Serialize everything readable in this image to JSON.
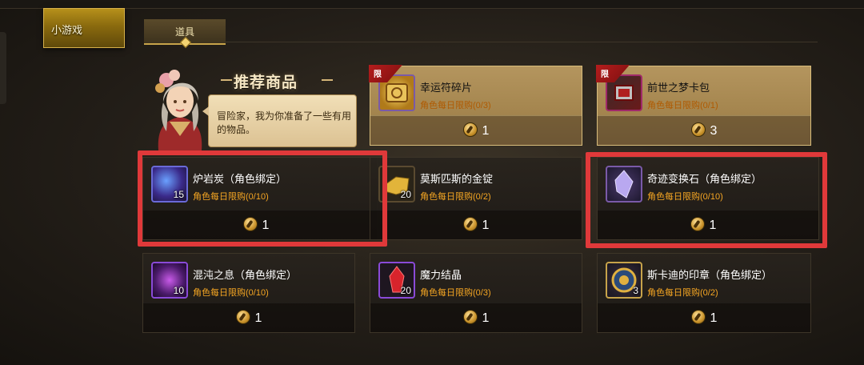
{
  "tabs": [
    {
      "label": "小游戏",
      "active": true
    },
    {
      "label": "道具",
      "active": false
    }
  ],
  "recommend": {
    "title": "推荐商品",
    "speech": "冒险家，我为你准备了一些有用的物品。"
  },
  "items": [
    {
      "name": "幸运符碎片",
      "limit": "角色每日限购(0/3)",
      "price": "1",
      "qty": "",
      "ribbon": "限",
      "icon": "scroll-icon"
    },
    {
      "name": "前世之梦卡包",
      "limit": "角色每日限购(0/1)",
      "price": "3",
      "qty": "",
      "ribbon": "限",
      "icon": "card-pack-icon"
    },
    {
      "name": "炉岩炭（角色绑定）",
      "limit": "角色每日限购(0/10)",
      "price": "1",
      "qty": "15",
      "icon": "lava-stone-icon"
    },
    {
      "name": "莫斯匹斯的金锭",
      "limit": "角色每日限购(0/2)",
      "price": "1",
      "qty": "20",
      "icon": "gold-ingot-icon"
    },
    {
      "name": "奇迹变换石（角色绑定）",
      "limit": "角色每日限购(0/10)",
      "price": "1",
      "qty": "",
      "icon": "crystal-icon"
    },
    {
      "name": "混沌之息（角色绑定）",
      "limit": "角色每日限购(0/10)",
      "price": "1",
      "qty": "10",
      "icon": "chaos-breath-icon"
    },
    {
      "name": "魔力结晶",
      "limit": "角色每日限购(0/3)",
      "price": "1",
      "qty": "20",
      "icon": "mana-crystal-icon"
    },
    {
      "name": "斯卡迪的印章（角色绑定）",
      "limit": "角色每日限购(0/2)",
      "price": "1",
      "qty": "3",
      "icon": "seal-icon"
    }
  ],
  "colors": {
    "gold": "#c7a34a",
    "limit_text": "#f5a623",
    "highlight": "#e0393a"
  }
}
